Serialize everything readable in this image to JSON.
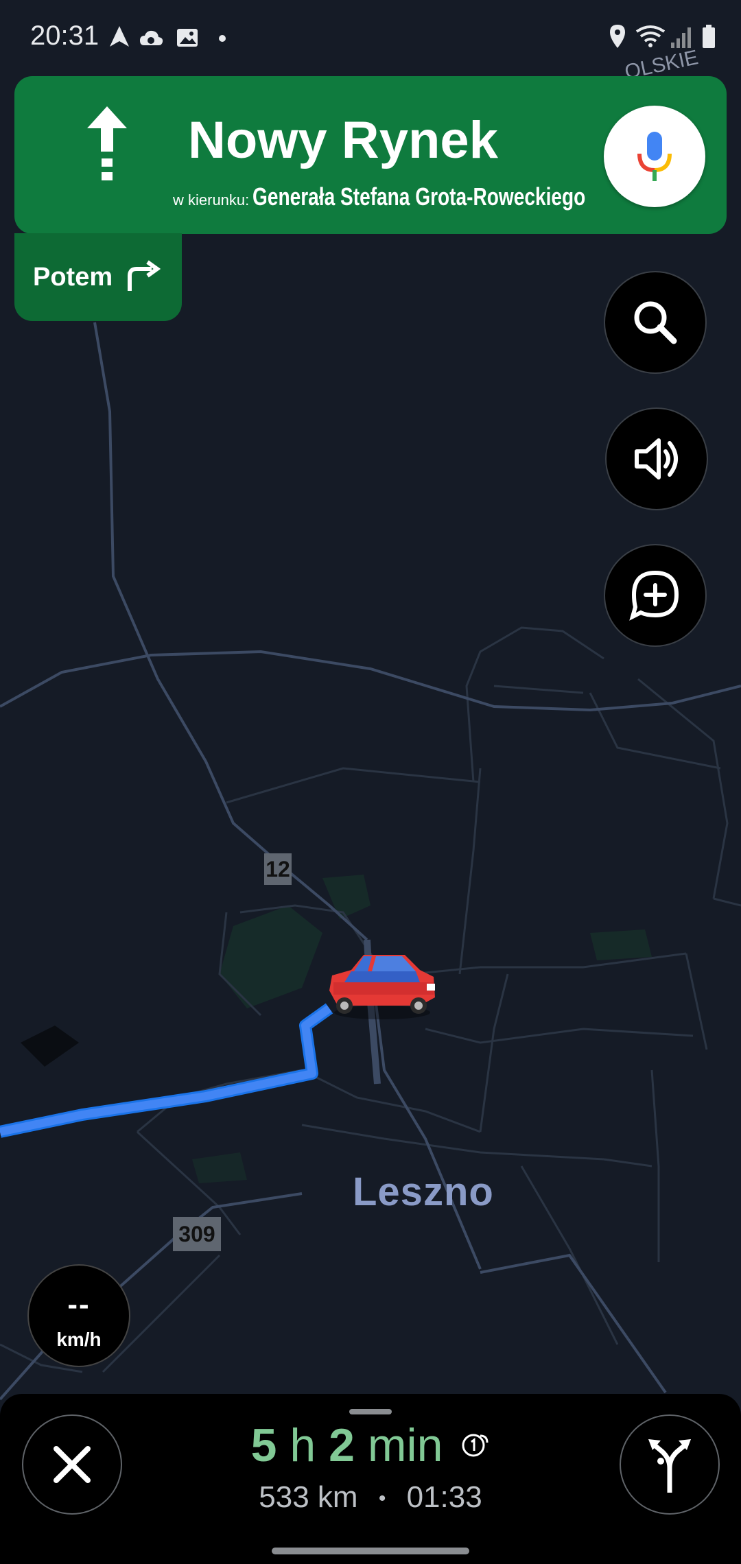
{
  "status_bar": {
    "time": "20:31"
  },
  "navigation": {
    "street": "Nowy Rynek",
    "direction_prefix": "w kierunku:",
    "direction_street": "Generała Stefana Grota-Roweckiego",
    "then_label": "Potem",
    "maneuver_icon": "arrow-straight-icon",
    "next_maneuver_icon": "turn-right-icon"
  },
  "map": {
    "city": "Leszno",
    "top_label": "OLSKIE",
    "road_shields": [
      "12",
      "309"
    ]
  },
  "speed": {
    "value": "--",
    "unit": "km/h"
  },
  "trip": {
    "eta_hours": "5",
    "eta_h_unit": "h",
    "eta_minutes": "2",
    "eta_min_unit": "min",
    "distance": "533 km",
    "separator": "•",
    "arrival": "01:33"
  },
  "colors": {
    "nav_green": "#0f7b3e",
    "route_blue": "#4285f4",
    "eta_green": "#81c995",
    "map_background": "#151b26"
  }
}
